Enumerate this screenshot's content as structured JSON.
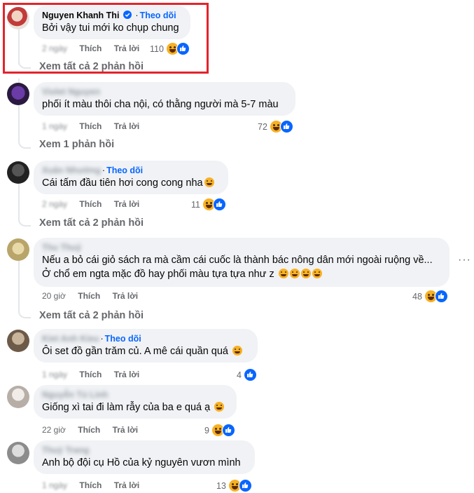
{
  "comments": [
    {
      "name": "Nguyen Khanh Thi",
      "verified": true,
      "follow": "Theo dõi",
      "text": "Bởi vậy tui mới ko chụp chung",
      "time": "2 ngày",
      "like": "Thích",
      "reply": "Trả lời",
      "reactions": "110",
      "view_replies": "Xem tất cả 2 phản hồi"
    },
    {
      "name": "Violet Nguyen",
      "text": "phối ít màu thôi cha nội, có thằng người mà 5-7 màu",
      "time": "1 ngày",
      "like": "Thích",
      "reply": "Trả lời",
      "reactions": "72",
      "view_replies": "Xem 1 phản hồi"
    },
    {
      "name": "Xuân Nhường",
      "follow": "Theo dõi",
      "text": "Cái tấm đầu tiên hơi cong cong nha",
      "time": "2 ngày",
      "like": "Thích",
      "reply": "Trả lời",
      "reactions": "11",
      "view_replies": "Xem tất cả 2 phản hồi"
    },
    {
      "name": "Thu Thuỷ",
      "text_line1": "Nếu a bỏ cái giỏ sách ra mà cầm cái cuốc là thành bác nông dân mới ngoài ruộng về...",
      "text_line2": "Ở chổ em ngta mặc đồ hay phối màu tựa tựa như z",
      "time": "20 giờ",
      "like": "Thích",
      "reply": "Trả lời",
      "reactions": "48",
      "view_replies": "Xem tất cả 2 phản hồi"
    },
    {
      "name": "Kiet Anh Kieu",
      "follow": "Theo dõi",
      "text": "Ôi set đồ gần trăm củ. A mê cái quần quá",
      "time": "1 ngày",
      "like": "Thích",
      "reply": "Trả lời",
      "reactions": "4"
    },
    {
      "name": "Nguyễn Tú Linh",
      "text": "Giống xì tai đi làm rẫy của ba e quá ạ",
      "time": "22 giờ",
      "like": "Thích",
      "reply": "Trả lời",
      "reactions": "9"
    },
    {
      "name": "Thuý Trang",
      "text": "Anh bộ đội cụ Hồ của kỷ nguyên vươn mình",
      "time": "1 ngày",
      "like": "Thích",
      "reply": "Trả lời",
      "reactions": "13"
    }
  ],
  "colors": {
    "accent": "#0866ff",
    "highlight": "#e3242b",
    "bubble": "#f0f2f5"
  },
  "icons": {
    "verified": "verified-badge-icon",
    "haha": "haha-reaction-icon",
    "like": "like-reaction-icon",
    "more": "more-options-icon"
  }
}
